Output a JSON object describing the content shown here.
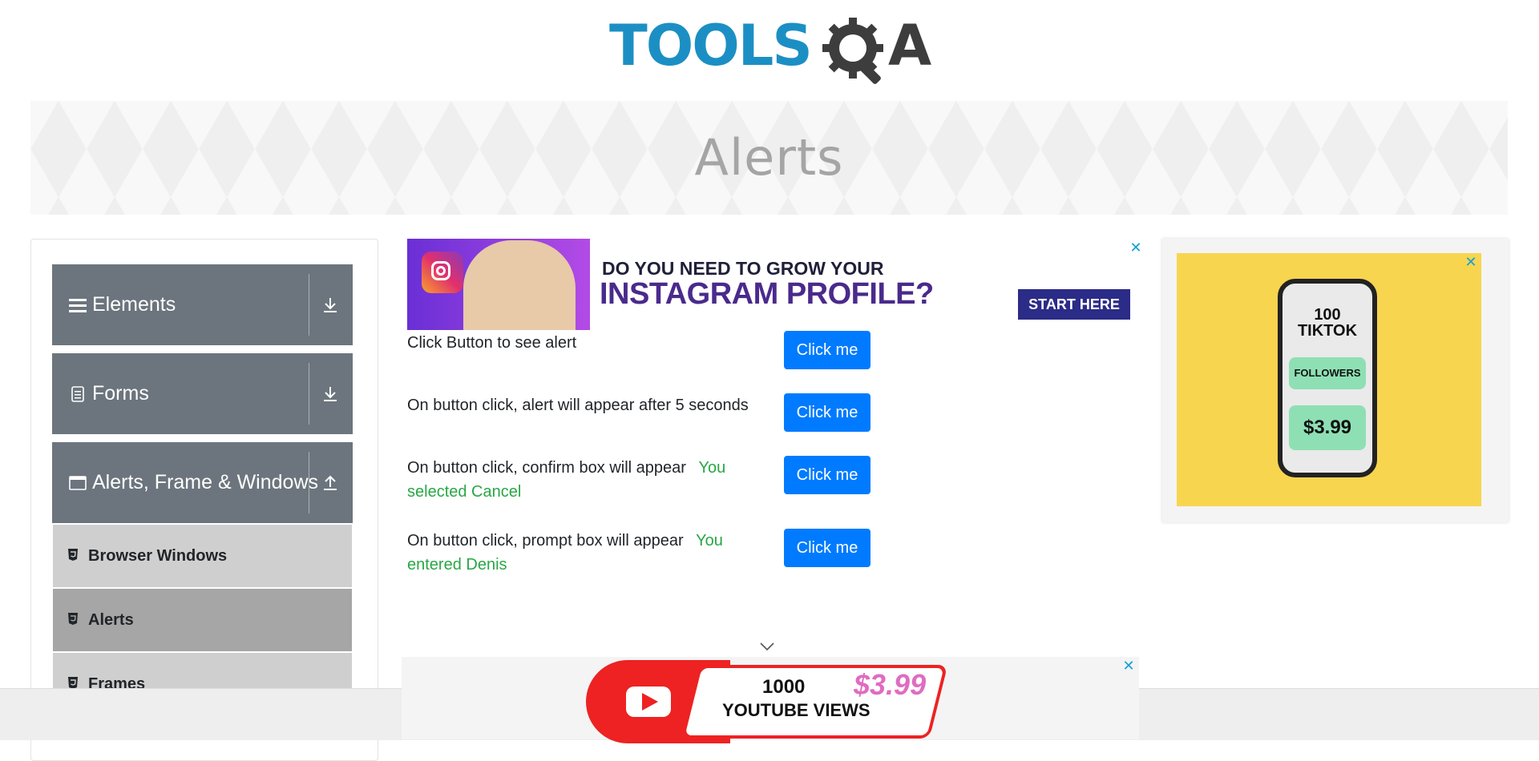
{
  "header": {
    "logo_text_tools": "TOOLS",
    "logo_text_a": "A"
  },
  "banner": {
    "title": "Alerts"
  },
  "sidebar": {
    "groups": [
      {
        "label": "Elements",
        "icon": "hamburger-icon",
        "arrow": "download-icon"
      },
      {
        "label": "Forms",
        "icon": "document-icon",
        "arrow": "download-icon"
      },
      {
        "label": "Alerts, Frame & Windows",
        "icon": "window-icon",
        "arrow": "upload-icon"
      }
    ],
    "items": [
      {
        "label": "Browser Windows",
        "icon": "html5-icon"
      },
      {
        "label": "Alerts",
        "icon": "html5-icon",
        "active": true
      },
      {
        "label": "Frames",
        "icon": "html5-icon"
      }
    ]
  },
  "ad_top": {
    "headline_1": "DO YOU NEED TO GROW YOUR",
    "headline_2": "INSTAGRAM PROFILE?",
    "cta": "START HERE",
    "close": "✕"
  },
  "alerts": [
    {
      "text": "Click Button to see alert",
      "result": "",
      "button": "Click me"
    },
    {
      "text": "On button click, alert will appear after 5 seconds",
      "result": "",
      "button": "Click me"
    },
    {
      "text": "On button click, confirm box will appear",
      "result": "You selected Cancel",
      "button": "Click me"
    },
    {
      "text": "On button click, prompt box will appear",
      "result": "You entered Denis",
      "button": "Click me"
    }
  ],
  "ad_right": {
    "line1": "100",
    "line2": "TIKTOK",
    "line3": "FOLLOWERS",
    "price": "$3.99",
    "close": "✕"
  },
  "ad_bottom": {
    "line1": "1000",
    "line2": "YOUTUBE VIEWS",
    "price": "$3.99",
    "close": "✕"
  },
  "colors": {
    "primary_button": "#007bff",
    "sidebar_group": "#6c757d",
    "result_text": "#28a745",
    "logo_blue": "#1b8fc4"
  }
}
